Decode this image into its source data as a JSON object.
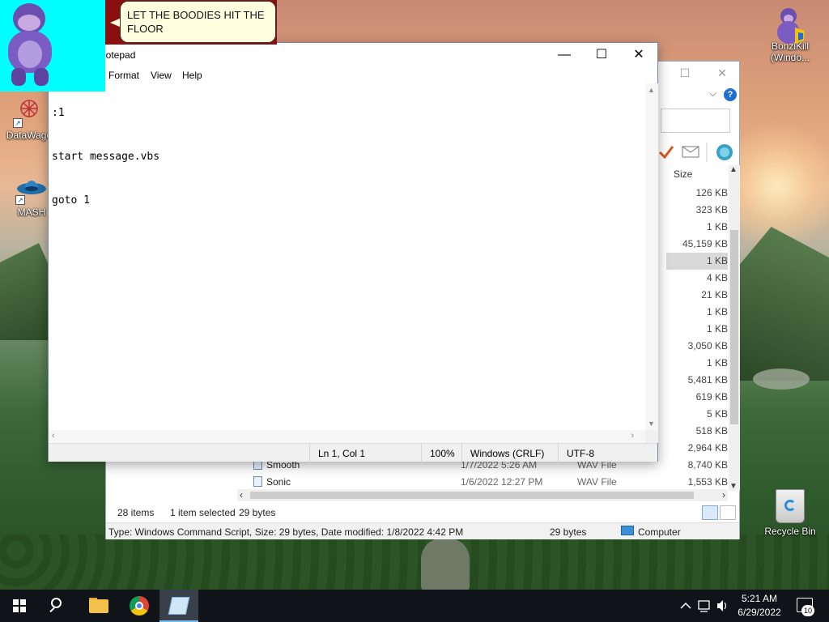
{
  "bonzi": {
    "speech": "LET THE BOODIES HIT THE FLOOR"
  },
  "desktop": {
    "icons": [
      {
        "label": "DataWago",
        "icon": "datawago-icon"
      },
      {
        "label": "MASH",
        "icon": "mash-icon"
      },
      {
        "label": "BonziKill (Windo...",
        "icon": "bonzikill-icon"
      },
      {
        "label": "Recycle Bin",
        "icon": "recycle-bin-icon"
      }
    ]
  },
  "notepad": {
    "title": "Notepad",
    "menu": [
      "Format",
      "View",
      "Help"
    ],
    "lines": [
      ":1",
      "start message.vbs",
      "goto 1"
    ],
    "status": {
      "position": "Ln 1, Col 1",
      "zoom": "100%",
      "line_ending": "Windows (CRLF)",
      "encoding": "UTF-8"
    }
  },
  "explorer": {
    "size_header": "Size",
    "sizes": [
      "126 KB",
      "323 KB",
      "1 KB",
      "45,159 KB",
      "1 KB",
      "4 KB",
      "21 KB",
      "1 KB",
      "1 KB",
      "3,050 KB",
      "1 KB",
      "5,481 KB",
      "619 KB",
      "5 KB",
      "518 KB",
      "2,964 KB"
    ],
    "files": [
      {
        "name": "Smooth",
        "date": "1/7/2022 5:26 AM",
        "type": "WAV File",
        "size": "8,740 KB"
      },
      {
        "name": "Sonic",
        "date": "1/6/2022 12:27 PM",
        "type": "WAV File",
        "size": "1,553 KB"
      }
    ],
    "status": {
      "items": "28 items",
      "selected": "1 item selected",
      "bytes": "29 bytes"
    },
    "details": {
      "text": "Type: Windows Command Script, Size: 29 bytes, Date modified: 1/8/2022 4:42 PM",
      "size": "29 bytes",
      "location": "Computer"
    }
  },
  "taskbar": {
    "time": "5:21 AM",
    "date": "6/29/2022",
    "notifications": "10"
  }
}
